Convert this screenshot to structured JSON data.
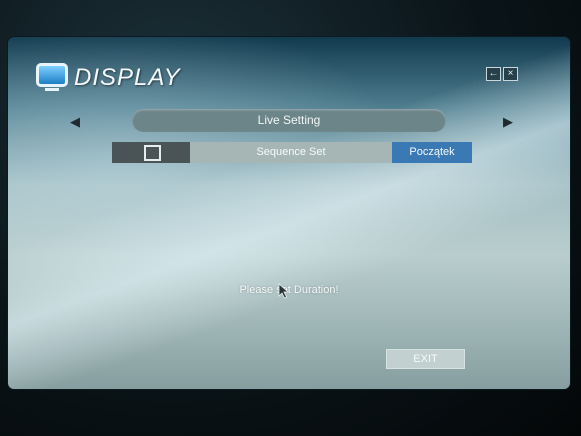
{
  "window": {
    "title": "DISPLAY",
    "icon": "display-icon",
    "back_glyph": "←",
    "close_glyph": "×"
  },
  "mode_selector": {
    "label": "Live Setting",
    "prev_glyph": "◀",
    "next_glyph": "▶"
  },
  "tabs": {
    "sequence_label": "Sequence Set",
    "start_label": "Początek"
  },
  "message": "Please set Duration!",
  "buttons": {
    "exit_label": "EXIT"
  },
  "colors": {
    "accent": "#3b79b5",
    "bar": "#6c8588"
  }
}
